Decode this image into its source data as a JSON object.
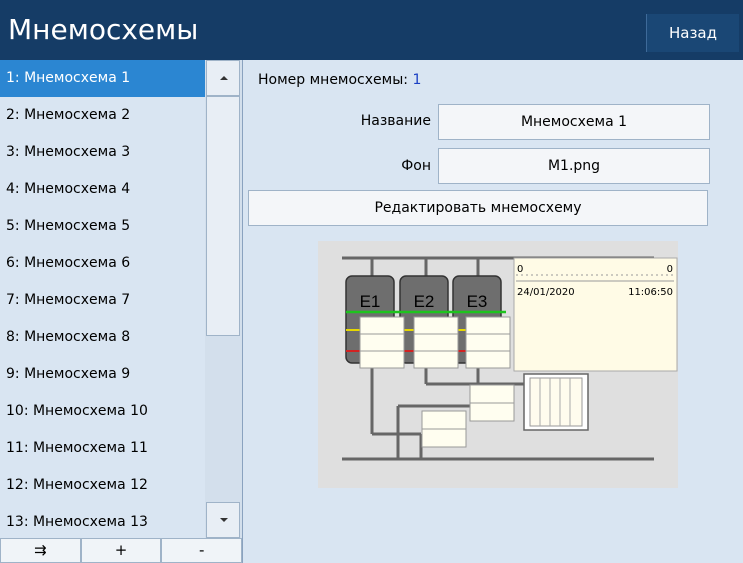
{
  "header": {
    "title": "Мнемосхемы",
    "back_label": "Назад"
  },
  "list": {
    "items": [
      {
        "label": "1: Мнемосхема 1"
      },
      {
        "label": "2: Мнемосхема 2"
      },
      {
        "label": "3: Мнемосхема 3"
      },
      {
        "label": "4: Мнемосхема 4"
      },
      {
        "label": "5: Мнемосхема 5"
      },
      {
        "label": "6: Мнемосхема 6"
      },
      {
        "label": "7: Мнемосхема 7"
      },
      {
        "label": "8: Мнемосхема 8"
      },
      {
        "label": "9: Мнемосхема 9"
      },
      {
        "label": "10: Мнемосхема 10"
      },
      {
        "label": "11: Мнемосхема 11"
      },
      {
        "label": "12: Мнемосхема 12"
      },
      {
        "label": "13: Мнемосхема 13"
      }
    ],
    "selected_index": 0
  },
  "toolbar": {
    "move_label": "⇉",
    "add_label": "+",
    "remove_label": "-"
  },
  "details": {
    "number_label": "Номер мнемосхемы:",
    "number_value": "1",
    "name_label": "Название",
    "name_value": "Мнемосхема 1",
    "bg_label": "Фон",
    "bg_value": "M1.png",
    "edit_label": "Редактировать мнемосхему"
  },
  "preview": {
    "tanks": [
      "E1",
      "E2",
      "E3"
    ],
    "scale_left": "0",
    "scale_right": "0",
    "date": "24/01/2020",
    "time": "11:06:50"
  }
}
